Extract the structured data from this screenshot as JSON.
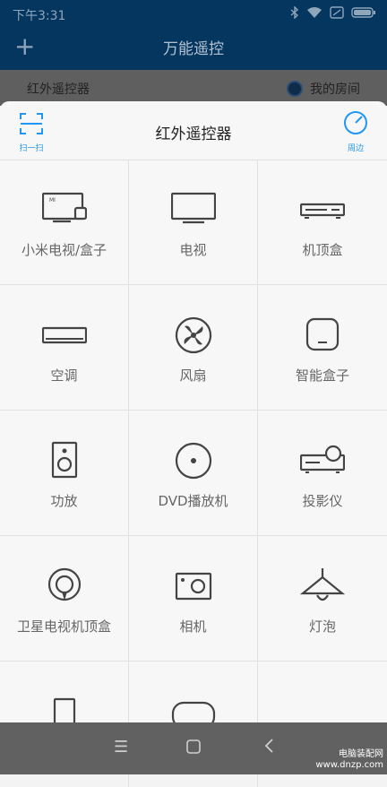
{
  "status": {
    "time": "下午3:31"
  },
  "app": {
    "title": "万能遥控"
  },
  "subbar": {
    "left": "红外遥控器",
    "right": "我的房间"
  },
  "sheet": {
    "title": "红外遥控器",
    "scan_label": "扫一扫",
    "nearby_label": "周边"
  },
  "grid": {
    "items": [
      {
        "label": "小米电视/盒子",
        "icon": "tv-box-icon"
      },
      {
        "label": "电视",
        "icon": "tv-icon"
      },
      {
        "label": "机顶盒",
        "icon": "set-top-box-icon"
      },
      {
        "label": "空调",
        "icon": "air-conditioner-icon"
      },
      {
        "label": "风扇",
        "icon": "fan-icon"
      },
      {
        "label": "智能盒子",
        "icon": "smart-box-icon"
      },
      {
        "label": "功放",
        "icon": "amplifier-icon"
      },
      {
        "label": "DVD播放机",
        "icon": "dvd-icon"
      },
      {
        "label": "投影仪",
        "icon": "projector-icon"
      },
      {
        "label": "卫星电视机顶盒",
        "icon": "satellite-icon"
      },
      {
        "label": "相机",
        "icon": "camera-icon"
      },
      {
        "label": "灯泡",
        "icon": "lamp-icon"
      }
    ]
  },
  "watermark": {
    "line1": "电脑装配网",
    "line2": "www.dnzp.com"
  }
}
